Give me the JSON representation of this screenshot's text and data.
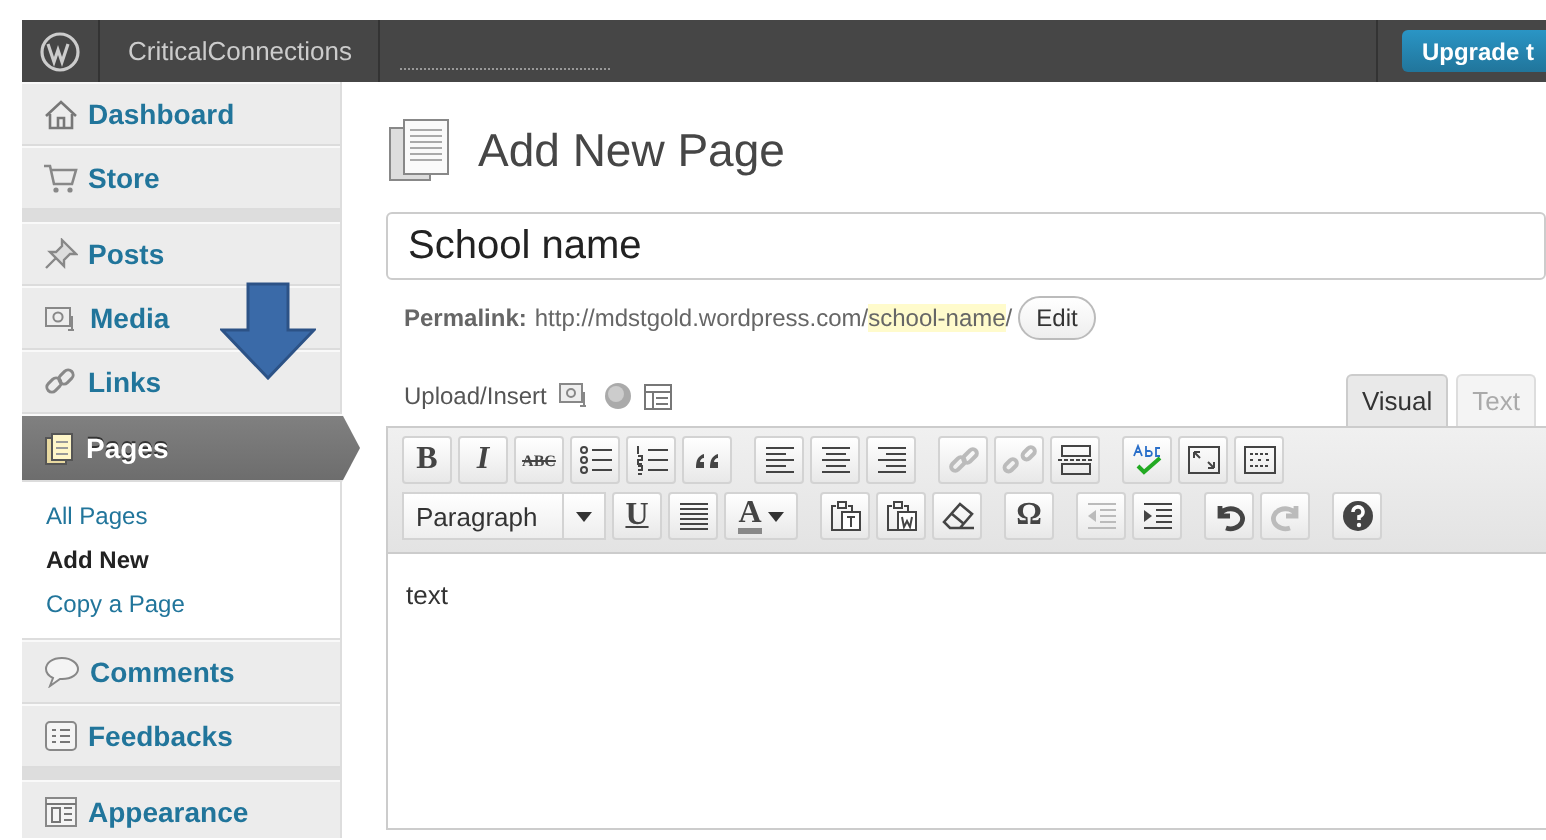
{
  "admin_bar": {
    "site_name": "CriticalConnections",
    "upgrade_button": "Upgrade t"
  },
  "menu_groups": [
    {
      "items": [
        {
          "label": "Dashboard",
          "selected": false
        },
        {
          "label": "Store",
          "selected": false
        }
      ]
    },
    {
      "items": [
        {
          "label": "Posts",
          "selected": false
        },
        {
          "label": "Media",
          "selected": false
        },
        {
          "label": "Links",
          "selected": false
        },
        {
          "label": "Pages",
          "selected": true,
          "children": [
            {
              "label": "All Pages",
              "selected": false
            },
            {
              "label": "Add New",
              "selected": true
            },
            {
              "label": "Copy a Page",
              "selected": false
            }
          ]
        },
        {
          "label": "Comments",
          "selected": false
        },
        {
          "label": "Feedbacks",
          "selected": false
        }
      ]
    },
    {
      "items": [
        {
          "label": "Appearance",
          "selected": false
        }
      ]
    }
  ],
  "page_title": "Add New Page",
  "title_field": {
    "value": "School name"
  },
  "permalink": {
    "label": "Permalink:",
    "base": "http://mdstgold.wordpress.com/",
    "slug": "school-name",
    "tail": "/",
    "edit_button": "Edit"
  },
  "upload_insert": "Upload/Insert",
  "editor_tabs": [
    {
      "label": "Visual",
      "selected": true
    },
    {
      "label": "Text",
      "selected": false
    }
  ],
  "toolbar_rows": [
    [
      {
        "kind": "bold",
        "glyph": "B",
        "disabled": false
      },
      {
        "kind": "italic",
        "glyph": "I",
        "disabled": false
      },
      {
        "kind": "strikethrough",
        "glyph": "ABC",
        "disabled": false
      },
      {
        "kind": "bullets",
        "disabled": false
      },
      {
        "kind": "numbers",
        "disabled": false
      },
      {
        "kind": "quote",
        "disabled": false
      },
      {
        "kind": "align-left",
        "disabled": false
      },
      {
        "kind": "align-center",
        "disabled": false
      },
      {
        "kind": "align-right",
        "disabled": false
      },
      {
        "kind": "link",
        "disabled": true
      },
      {
        "kind": "unlink",
        "disabled": true
      },
      {
        "kind": "more",
        "disabled": false
      },
      {
        "kind": "spellcheck",
        "disabled": false
      },
      {
        "kind": "fullscreen",
        "disabled": false
      },
      {
        "kind": "kitchen-sink",
        "disabled": false
      }
    ],
    [
      {
        "kind": "format",
        "value": "Paragraph",
        "disabled": false
      },
      {
        "kind": "underline",
        "glyph": "U",
        "disabled": false
      },
      {
        "kind": "justify",
        "disabled": false
      },
      {
        "kind": "text-color",
        "glyph": "A",
        "disabled": false
      },
      {
        "kind": "paste-text",
        "disabled": false
      },
      {
        "kind": "paste-word",
        "disabled": false
      },
      {
        "kind": "eraser",
        "disabled": false
      },
      {
        "kind": "special-char",
        "glyph": "Ω",
        "disabled": false
      },
      {
        "kind": "outdent",
        "disabled": true
      },
      {
        "kind": "indent",
        "disabled": false
      },
      {
        "kind": "undo",
        "disabled": false
      },
      {
        "kind": "redo",
        "disabled": true
      },
      {
        "kind": "help",
        "disabled": false
      }
    ]
  ],
  "editor_content": "text"
}
